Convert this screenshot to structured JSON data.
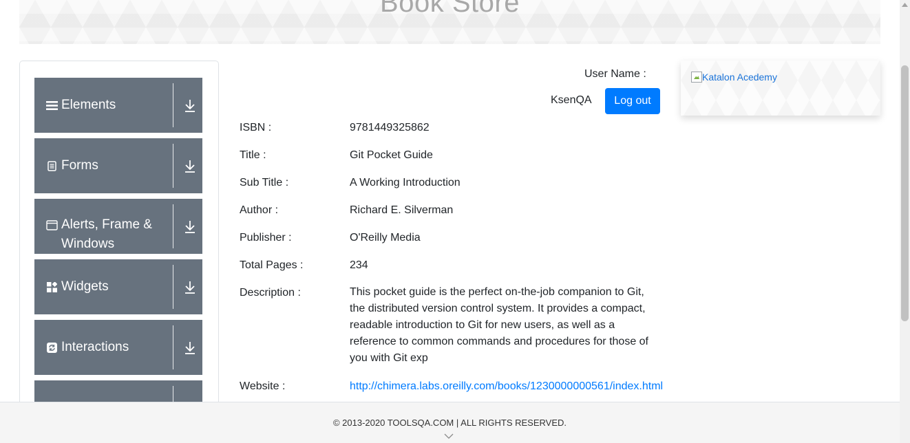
{
  "header": {
    "title": "Book Store"
  },
  "sidebar": {
    "groups": [
      {
        "label": "Elements",
        "icon": "hamburger-icon"
      },
      {
        "label": "Forms",
        "icon": "document-icon"
      },
      {
        "label": "Alerts, Frame & Windows",
        "icon": "window-icon"
      },
      {
        "label": "Widgets",
        "icon": "widgets-icon"
      },
      {
        "label": "Interactions",
        "icon": "refresh-icon"
      },
      {
        "label": "",
        "icon": ""
      }
    ]
  },
  "user": {
    "label": "User Name :",
    "value": "KsenQA",
    "logout": "Log out"
  },
  "book": {
    "isbn_label": "ISBN :",
    "isbn": "9781449325862",
    "title_label": "Title :",
    "title": "Git Pocket Guide",
    "subtitle_label": "Sub Title :",
    "subtitle": "A Working Introduction",
    "author_label": "Author :",
    "author": "Richard E. Silverman",
    "publisher_label": "Publisher :",
    "publisher": "O'Reilly Media",
    "pages_label": "Total Pages :",
    "pages": "234",
    "description_label": "Description :",
    "description_lines": [
      "This pocket guide is the perfect on-the-job companion to Git,",
      "the distributed version control system. It provides a compact,",
      "readable introduction to Git for new users, as well as a",
      "reference to common commands and procedures for those of",
      "you with Git exp"
    ],
    "website_label": "Website :",
    "website": "http://chimera.labs.oreilly.com/books/1230000000561/index.html"
  },
  "ad": {
    "alt": "Katalon Acedemy"
  },
  "footer": {
    "text": "© 2013-2020 TOOLSQA.COM | ALL RIGHTS RESERVED."
  },
  "colors": {
    "sidebar_group": "#67727e",
    "primary": "#007bff",
    "footer_bg": "#f5f5f5"
  }
}
